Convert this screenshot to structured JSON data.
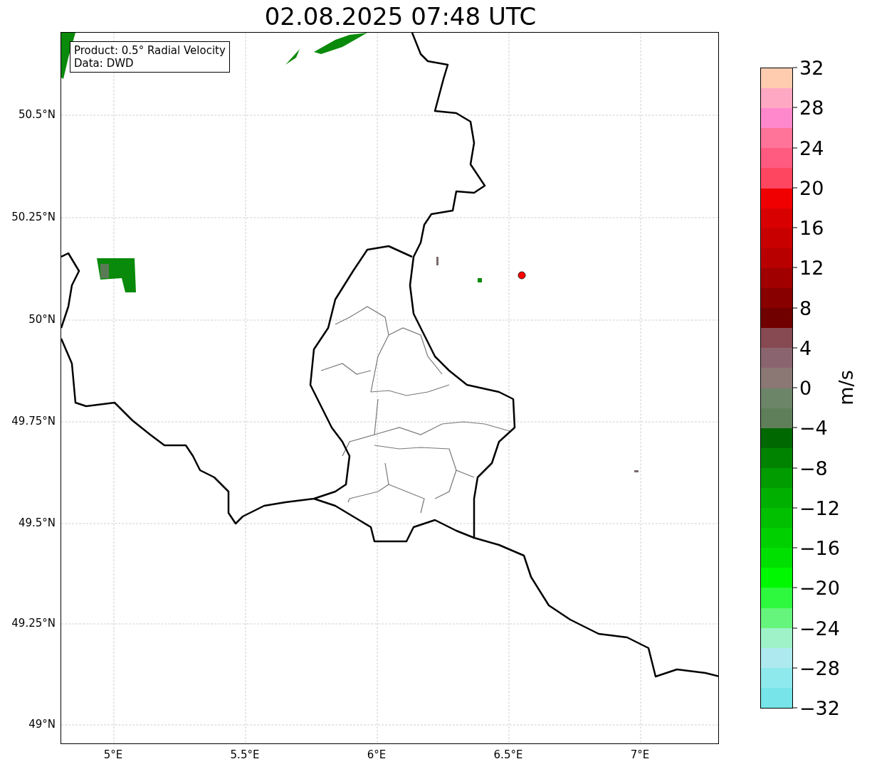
{
  "title": "02.08.2025 07:48 UTC",
  "info_box": {
    "lines": [
      "Product: 0.5° Radial Velocity",
      "Data: DWD"
    ]
  },
  "map": {
    "lat_labels": [
      "50.5°N",
      "50.25°N",
      "50°N",
      "49.75°N",
      "49.5°N",
      "49.25°N",
      "49°N"
    ],
    "lon_labels": [
      "5°E",
      "5.5°E",
      "6°E",
      "6.5°E",
      "7°E"
    ]
  },
  "colorbar": {
    "label": "m/s",
    "ticks": [
      "32",
      "28",
      "24",
      "20",
      "16",
      "12",
      "8",
      "4",
      "0",
      "−4",
      "−8",
      "−12",
      "−16",
      "−20",
      "−24",
      "−28",
      "−32"
    ],
    "segments": [
      {
        "color": "#ffccb0"
      },
      {
        "color": "#ffa8c4"
      },
      {
        "color": "#ff88cc"
      },
      {
        "color": "#ff7498"
      },
      {
        "color": "#ff5a80"
      },
      {
        "color": "#ff4660"
      },
      {
        "color": "#f00000"
      },
      {
        "color": "#d80000"
      },
      {
        "color": "#c80000"
      },
      {
        "color": "#b80000"
      },
      {
        "color": "#a00000"
      },
      {
        "color": "#880000"
      },
      {
        "color": "#700000"
      },
      {
        "color": "#874a52"
      },
      {
        "color": "#8a6570"
      },
      {
        "color": "#8b7875"
      },
      {
        "color": "#6c8569"
      },
      {
        "color": "#5e7f5a"
      },
      {
        "color": "#006800"
      },
      {
        "color": "#008400"
      },
      {
        "color": "#009c00"
      },
      {
        "color": "#00b000"
      },
      {
        "color": "#00c000"
      },
      {
        "color": "#00d000"
      },
      {
        "color": "#00e000"
      },
      {
        "color": "#00f800"
      },
      {
        "color": "#2ef93e"
      },
      {
        "color": "#66f57c"
      },
      {
        "color": "#9ff2c8"
      },
      {
        "color": "#ade9ee"
      },
      {
        "color": "#8ee9ec"
      },
      {
        "color": "#76e4e8"
      }
    ]
  }
}
